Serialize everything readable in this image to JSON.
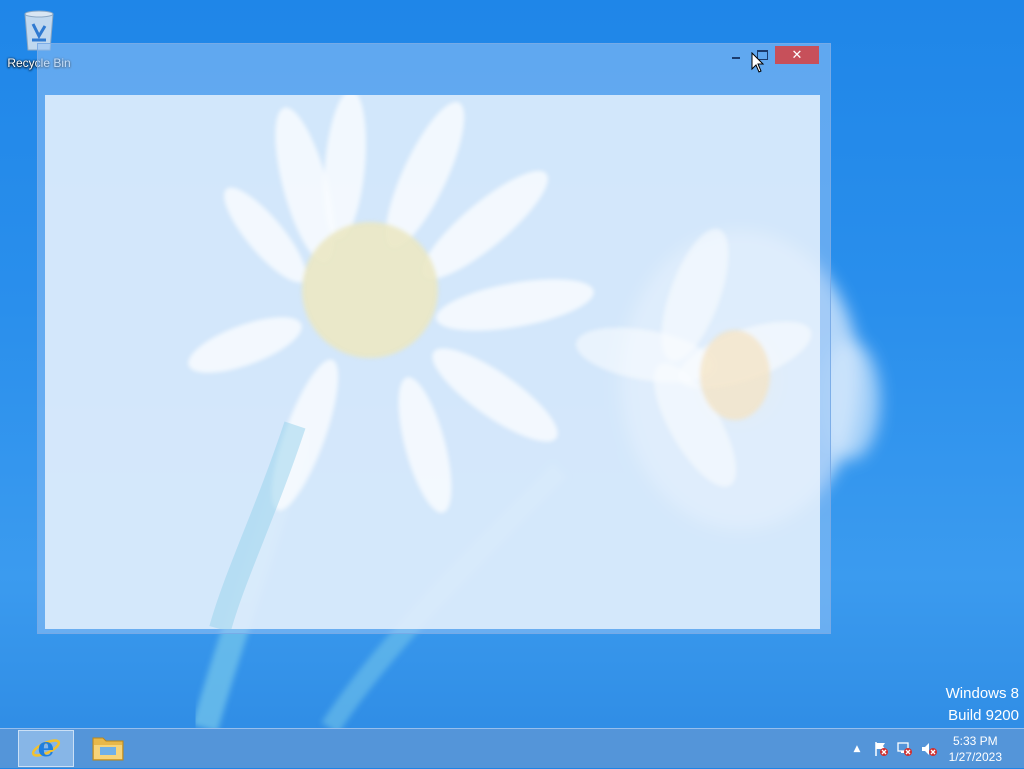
{
  "desktop": {
    "icons": [
      {
        "label": "Recycle Bin",
        "icon": "recycle-bin-icon"
      }
    ],
    "watermark": {
      "line1": "Windows 8",
      "line2": "Build 9200"
    }
  },
  "window": {
    "title": "",
    "controls": {
      "minimize": "minimize-icon",
      "maximize": "maximize-icon",
      "close": "close-icon",
      "close_glyph": "✕"
    }
  },
  "taskbar": {
    "pinned": [
      {
        "name": "Internet Explorer",
        "icon": "internet-explorer-icon",
        "active": true
      },
      {
        "name": "File Explorer",
        "icon": "file-explorer-icon",
        "active": false
      }
    ],
    "tray": {
      "show_hidden_glyph": "▲",
      "icons": [
        "action-center-flag-icon",
        "network-icon",
        "volume-muted-icon"
      ]
    },
    "clock": {
      "time": "5:33 PM",
      "date": "1/27/2023"
    }
  },
  "colors": {
    "close_button": "#c7505a",
    "desktop_blue": "#2a8fec"
  }
}
